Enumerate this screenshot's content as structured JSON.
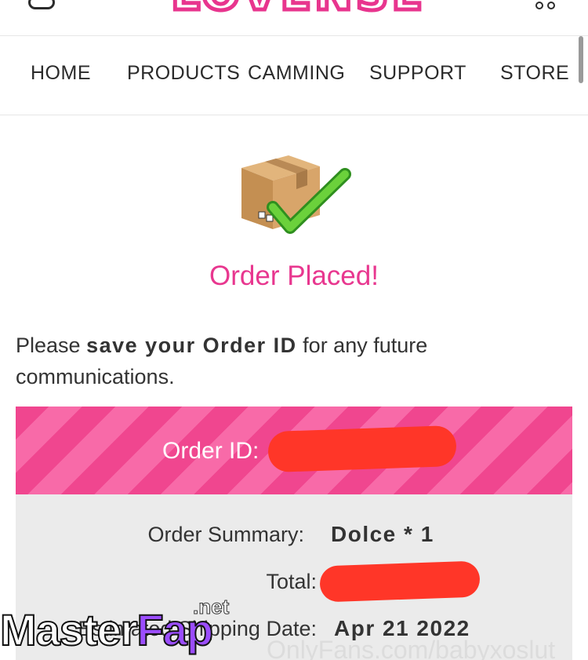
{
  "header": {
    "logo_text": "LOVENSE",
    "menu_icon": "menu-icon",
    "cart_icon": "cart-icon",
    "brand_color": "#e8358e"
  },
  "nav": {
    "items": [
      {
        "label": "HOME"
      },
      {
        "label": "PRODUCTS"
      },
      {
        "label": "CAMMING"
      },
      {
        "label": "SUPPORT"
      },
      {
        "label": "STORE"
      }
    ]
  },
  "main": {
    "icon": "package-checkmark-icon",
    "headline": "Order Placed!",
    "note_prefix": "Please ",
    "note_bold": "save your Order ID",
    "note_suffix": " for any future communications.",
    "order_id_label": "Order ID:",
    "summary": {
      "order_summary_label": "Order Summary:",
      "order_summary_value": "Dolce * 1",
      "total_label": "Total:",
      "shipping_label": "Estimated Shipping Date:",
      "shipping_value": "Apr 21 2022"
    },
    "accent_color": "#e8378f",
    "banner_color": "#f0468f"
  },
  "watermarks": {
    "site_master": "Master",
    "site_fap": "Fap",
    "site_net": ".net",
    "source": "OnlyFans.com/babyxoslut"
  }
}
